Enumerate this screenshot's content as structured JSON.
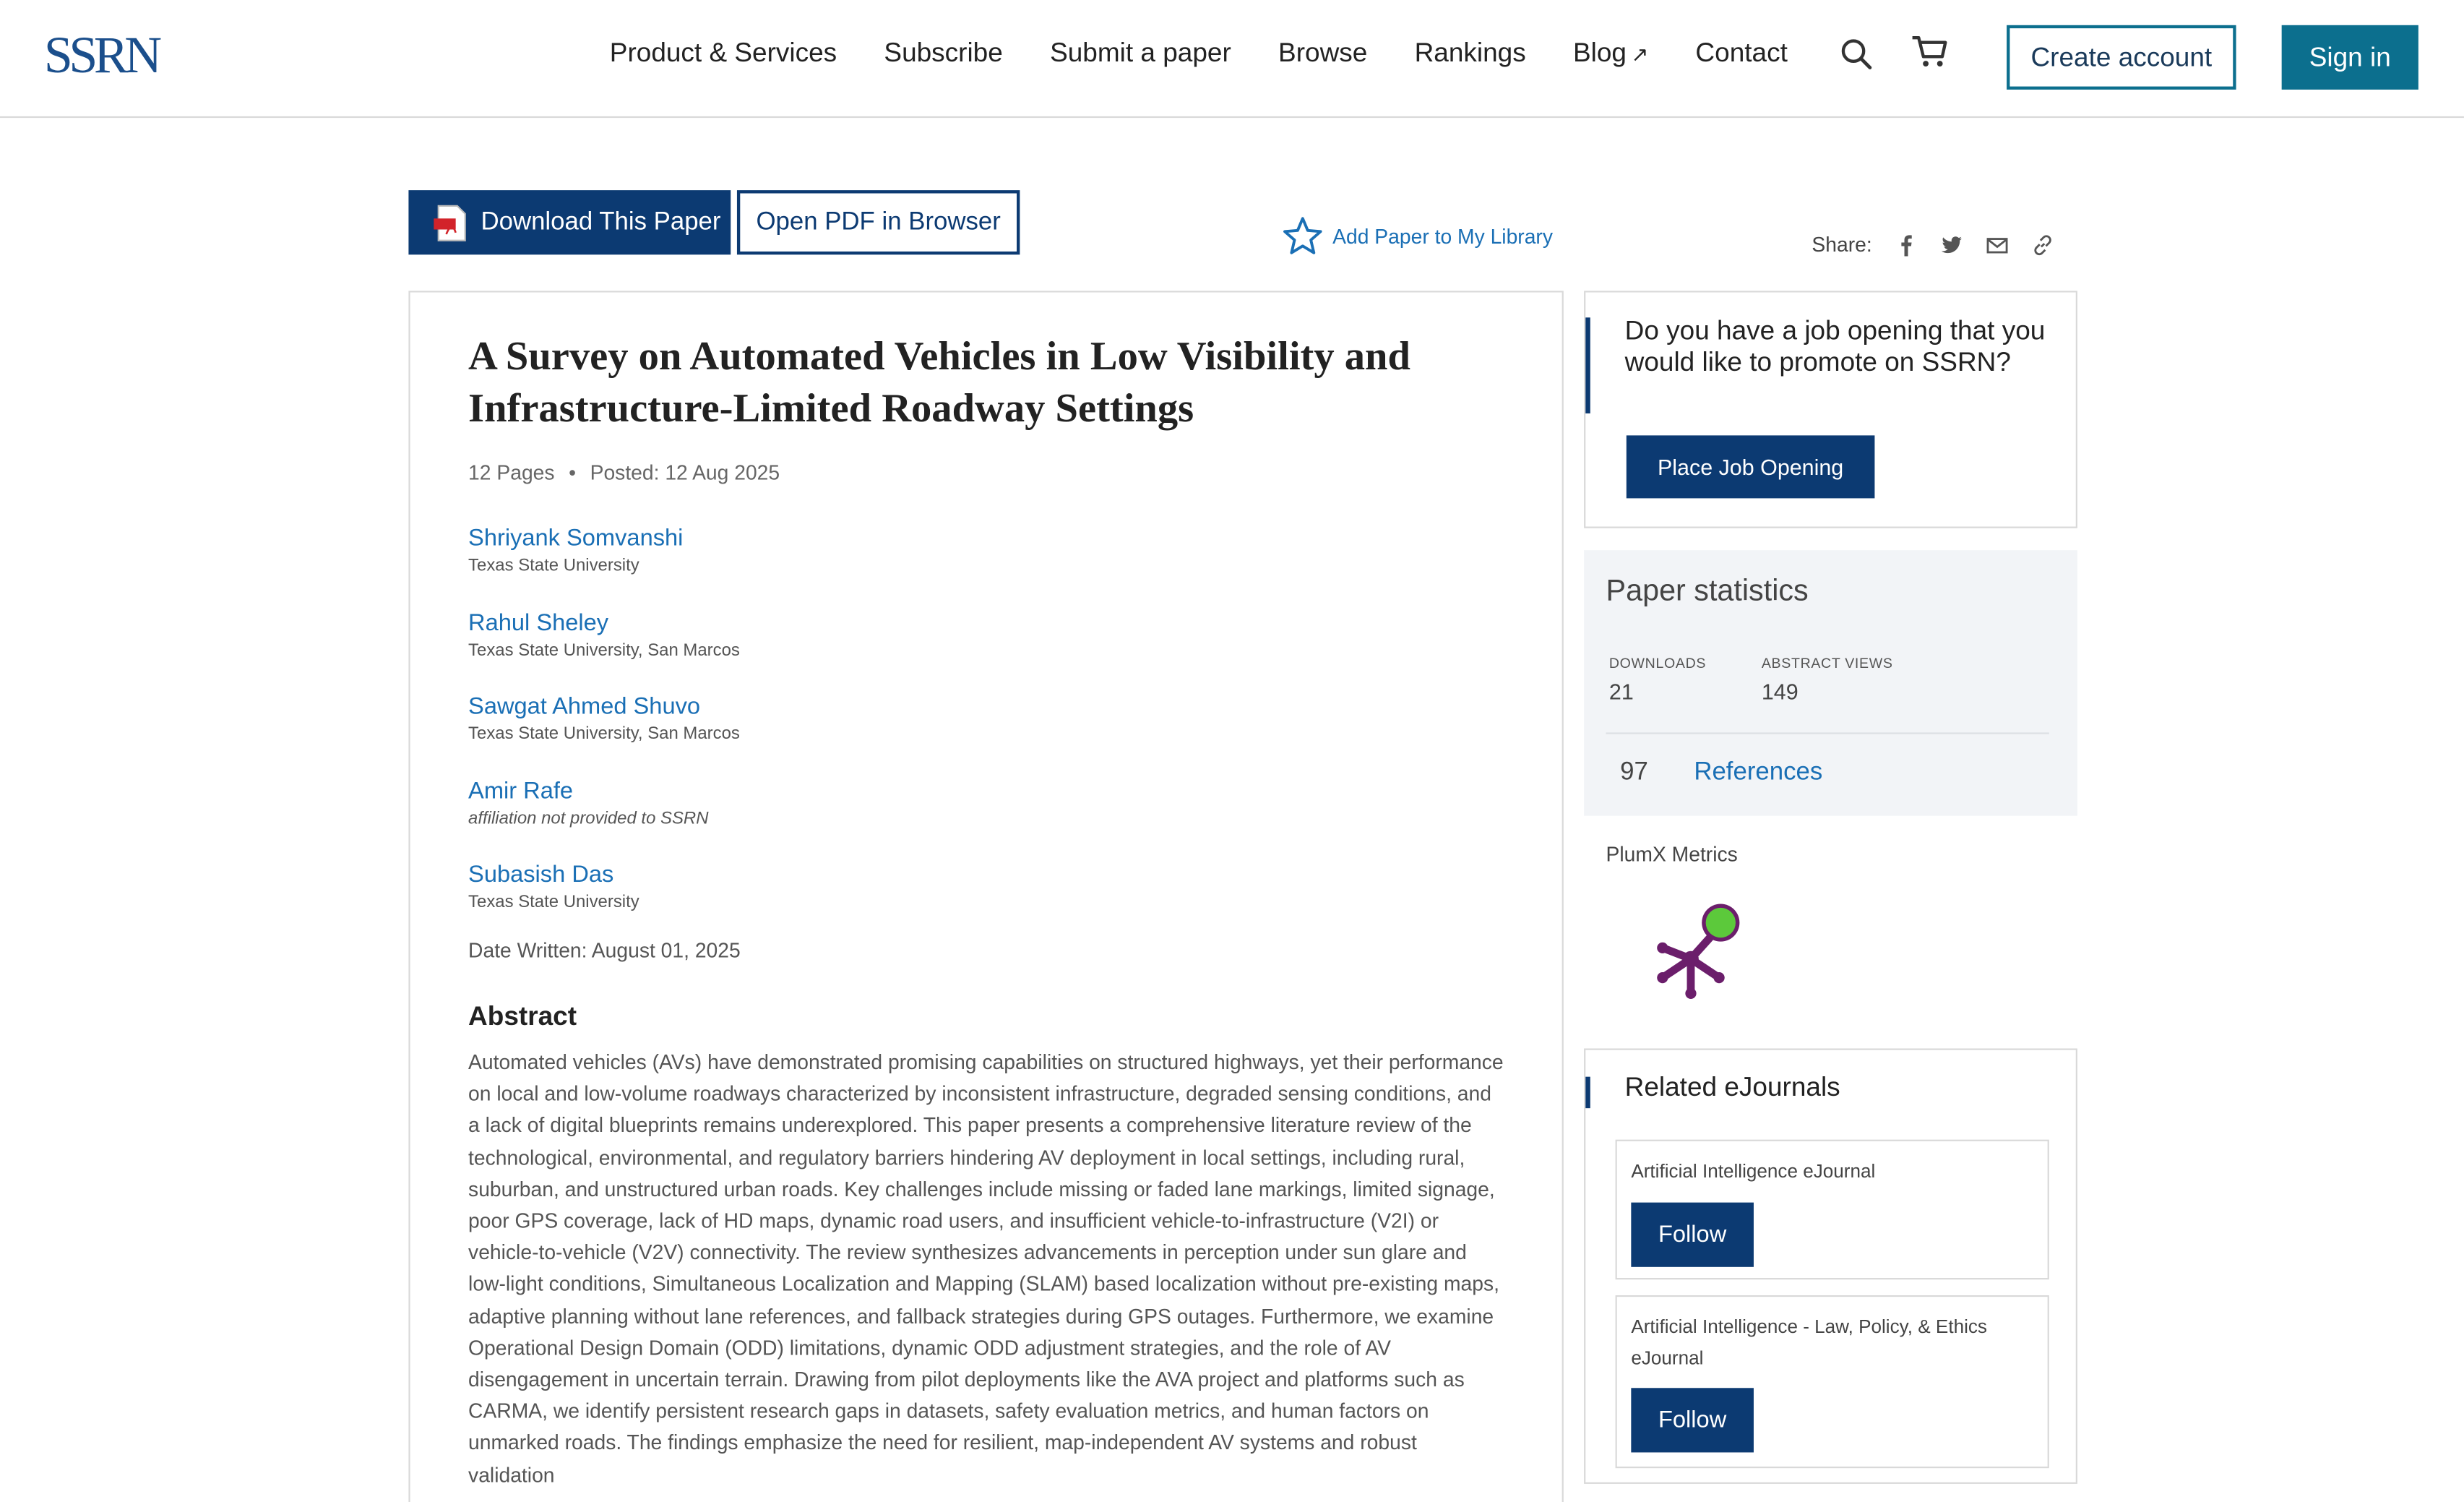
{
  "header": {
    "logo": "SSRN",
    "nav": [
      {
        "label": "Product & Services"
      },
      {
        "label": "Subscribe"
      },
      {
        "label": "Submit a paper"
      },
      {
        "label": "Browse"
      },
      {
        "label": "Rankings"
      },
      {
        "label": "Blog",
        "external_mark": "↗"
      },
      {
        "label": "Contact"
      }
    ],
    "create_account": "Create account",
    "sign_in": "Sign in",
    "icons": [
      "search-icon",
      "cart-icon"
    ]
  },
  "actions": {
    "download": "Download This Paper",
    "open_pdf": "Open PDF in Browser",
    "add_library": "Add Paper to My Library",
    "share_label": "Share:",
    "share_icons": [
      "facebook-icon",
      "twitter-icon",
      "email-icon",
      "link-icon"
    ]
  },
  "paper": {
    "title": "A Survey on Automated Vehicles in Low Visibility and Infrastructure-Limited Roadway Settings",
    "pages": "12 Pages",
    "posted": "Posted: 12 Aug 2025",
    "authors": [
      {
        "name": "Shriyank Somvanshi",
        "affiliation": "Texas State University"
      },
      {
        "name": "Rahul Sheley",
        "affiliation": "Texas State University, San Marcos"
      },
      {
        "name": "Sawgat Ahmed Shuvo",
        "affiliation": "Texas State University, San Marcos"
      },
      {
        "name": "Amir Rafe",
        "affiliation": "affiliation not provided to SSRN"
      },
      {
        "name": "Subasish Das",
        "affiliation": "Texas State University"
      }
    ],
    "date_written": "Date Written: August 01, 2025",
    "abstract_heading": "Abstract",
    "abstract": "Automated vehicles (AVs) have demonstrated promising capabilities on structured highways, yet their performance on local and low-volume roadways characterized by inconsistent infrastructure, degraded sensing conditions, and a lack of digital blueprints remains underexplored. This paper presents a comprehensive literature review of the technological, environmental, and regulatory barriers hindering AV deployment in local settings, including rural, suburban, and unstructured urban roads. Key challenges include missing or faded lane markings, limited signage, poor GPS coverage, lack of HD maps, dynamic road users, and insufficient vehicle-to-infrastructure (V2I) or vehicle-to-vehicle (V2V) connectivity. The review synthesizes advancements in perception under sun glare and low-light conditions, Simultaneous Localization and Mapping (SLAM) based localization without pre-existing maps, adaptive planning without lane references, and fallback strategies during GPS outages. Furthermore, we examine Operational Design Domain (ODD) limitations, dynamic ODD adjustment strategies, and the role of AV disengagement in uncertain terrain. Drawing from pilot deployments like the AVA project and platforms such as CARMA, we identify persistent research gaps in datasets, safety evaluation metrics, and human factors on unmarked roads. The findings emphasize the need for resilient, map-independent AV systems and robust validation"
  },
  "sidebar": {
    "job": {
      "question": "Do you have a job opening that you would like to promote on SSRN?",
      "button": "Place Job Opening"
    },
    "stats": {
      "heading": "Paper statistics",
      "downloads_label": "DOWNLOADS",
      "downloads": "21",
      "views_label": "ABSTRACT VIEWS",
      "views": "149",
      "references_count": "97",
      "references_label": "References"
    },
    "plumx_label": "PlumX Metrics",
    "related": {
      "heading": "Related eJournals",
      "journals": [
        {
          "name": "Artificial Intelligence eJournal",
          "follow": "Follow"
        },
        {
          "name": "Artificial Intelligence - Law, Policy, & Ethics eJournal",
          "follow": "Follow"
        }
      ]
    }
  },
  "colors": {
    "brand_navy": "#0c3a72",
    "brand_teal": "#0c6f8e",
    "link_blue": "#1a6fb5",
    "plumx_purple": "#6b1e6b",
    "plumx_green": "#5cc93b"
  }
}
